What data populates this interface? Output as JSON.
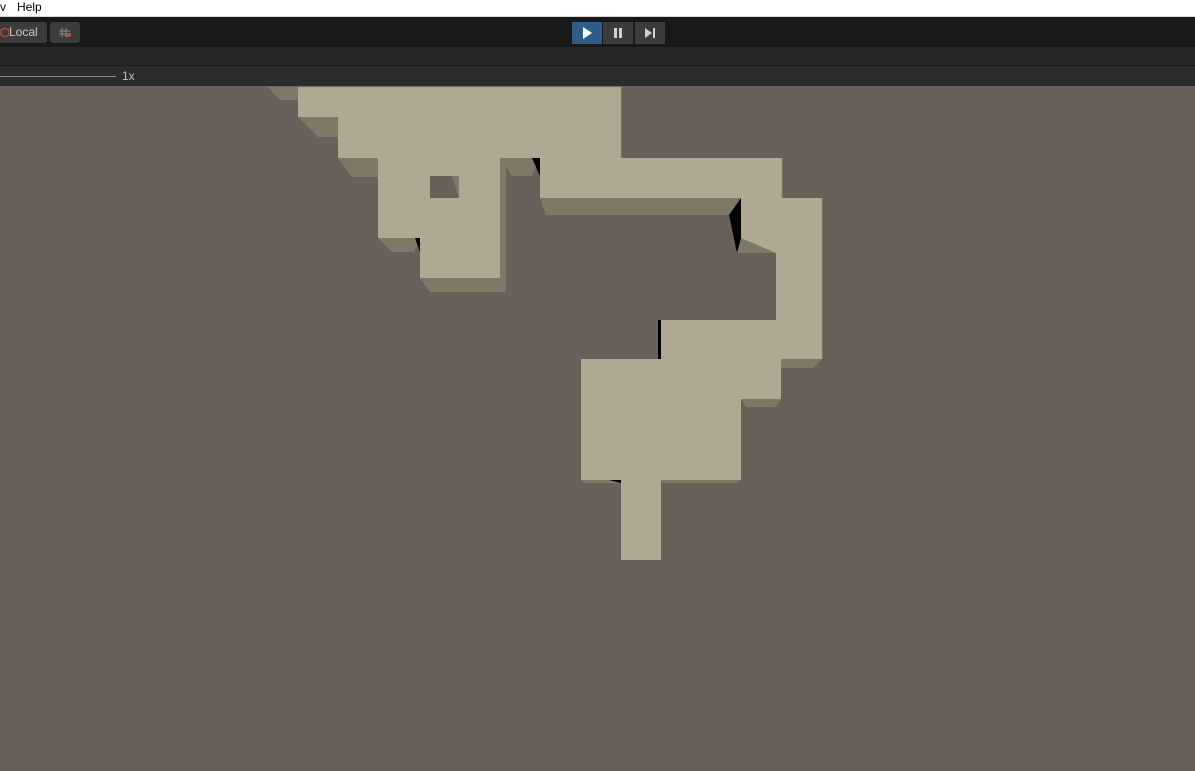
{
  "menu": {
    "partial_item": "v",
    "help": "Help"
  },
  "toolbar": {
    "pivot_label": "Local",
    "grid_icon": "grid-snap-icon",
    "play_icon": "play-icon",
    "pause_icon": "pause-icon",
    "step_icon": "step-forward-icon",
    "play_active": true
  },
  "game_view": {
    "scale_label": "1x"
  },
  "colors": {
    "background": "#6a605a",
    "wall_top": "#b0a893",
    "wall_side": "#7e7966",
    "wall_shadow": "#000000",
    "play_active": "#2f5d8a"
  }
}
